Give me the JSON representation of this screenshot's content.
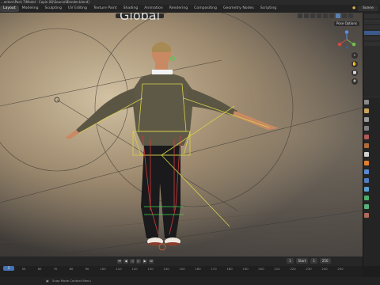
{
  "window": {
    "title": "...acters\\Pack 7\\Model - Copie (8)\\Source\\Blender.blend]"
  },
  "workspaces": {
    "tabs": [
      {
        "label": "Layout",
        "active": true
      },
      {
        "label": "Modeling",
        "active": false
      },
      {
        "label": "Sculpting",
        "active": false
      },
      {
        "label": "UV Editing",
        "active": false
      },
      {
        "label": "Texture Paint",
        "active": false
      },
      {
        "label": "Shading",
        "active": false
      },
      {
        "label": "Animation",
        "active": false
      },
      {
        "label": "Rendering",
        "active": false
      },
      {
        "label": "Compositing",
        "active": false
      },
      {
        "label": "Geometry Nodes",
        "active": false
      },
      {
        "label": "Scripting",
        "active": false
      }
    ],
    "scene": "Scene"
  },
  "viewport": {
    "mode": "Global",
    "pose_options": "Pose Options",
    "nav_icons": [
      "zoom-icon",
      "hand-icon",
      "camera-icon",
      "grid-icon"
    ]
  },
  "timeline": {
    "start_label": "Start",
    "start_value": "1",
    "end_value": "250",
    "current_value": "1",
    "ruler_ticks": [
      "50",
      "60",
      "70",
      "80",
      "90",
      "100",
      "110",
      "120",
      "130",
      "140",
      "150",
      "160",
      "170",
      "180",
      "190",
      "200",
      "210",
      "220",
      "230",
      "240",
      "250"
    ],
    "current_marker": "1"
  },
  "status": {
    "hint": "Snap Mode Context Menu"
  },
  "colors": {
    "accent": "#4772b3",
    "bone_yellow": "#d8d04a",
    "bone_red": "#d23c3c",
    "bone_green": "#3fcf4f"
  }
}
